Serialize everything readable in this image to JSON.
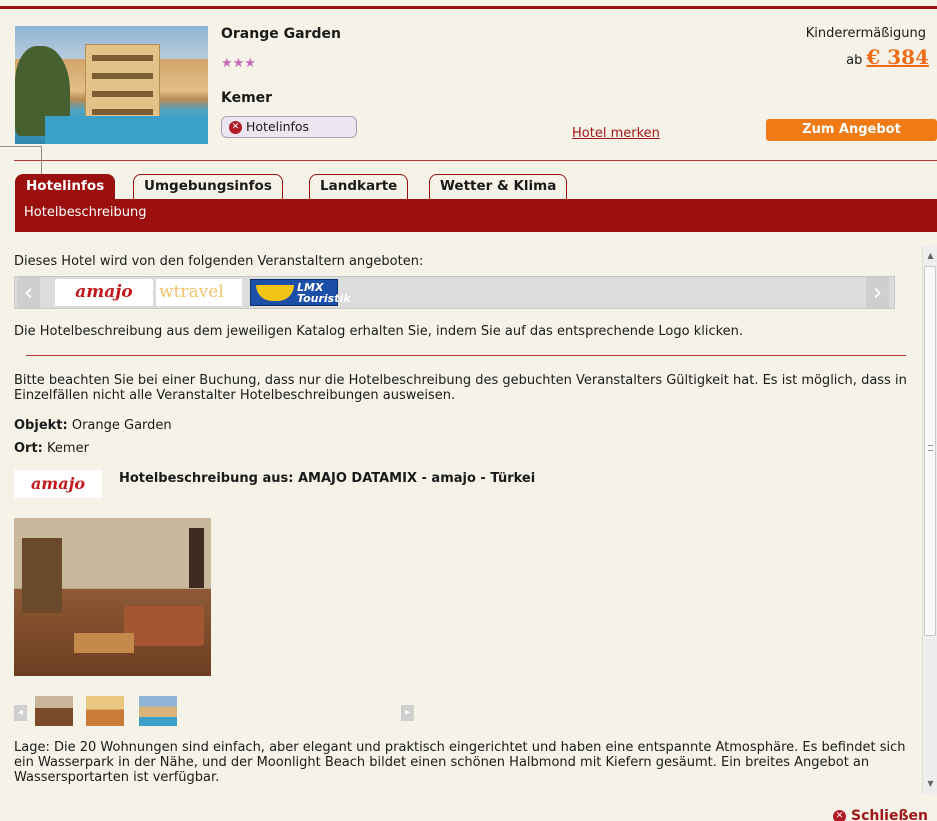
{
  "header": {
    "hotel_name": "Orange Garden",
    "stars": "★★★",
    "city": "Kemer",
    "hotelinfo_button": "Hotelinfos",
    "discount_label": "Kinderermäßigung",
    "price_prefix": "ab",
    "price": "€ 384",
    "merken_link": "Hotel merken",
    "offer_button": "Zum Angebot"
  },
  "tabs": [
    {
      "label": "Hotelinfos",
      "active": true
    },
    {
      "label": "Umgebungsinfos",
      "active": false
    },
    {
      "label": "Landkarte",
      "active": false
    },
    {
      "label": "Wetter & Klima",
      "active": false
    }
  ],
  "subtab": "Hotelbeschreibung",
  "content": {
    "intro": "Dieses Hotel wird von den folgenden Veranstaltern angeboten:",
    "operators": [
      "amajo",
      "wtravel",
      "LMX Touristik"
    ],
    "catalog_hint": "Die Hotelbeschreibung aus dem jeweiligen Katalog erhalten Sie, indem Sie auf das entsprechende Logo klicken.",
    "notice": "Bitte beachten Sie bei einer Buchung, dass nur die Hotelbeschreibung des gebuchten Veranstalters Gültigkeit hat. Es ist möglich, dass in Einzelfällen nicht alle Veranstalter Hotelbeschreibungen ausweisen.",
    "objekt_label": "Objekt:",
    "objekt_value": "Orange Garden",
    "ort_label": "Ort:",
    "ort_value": "Kemer",
    "desc_source": "Hotelbeschreibung aus: AMAJO DATAMIX - amajo - Türkei",
    "lage": "Lage: Die 20 Wohnungen sind einfach, aber elegant und praktisch eingerichtet und haben eine entspannte Atmosphäre. Es befindet sich ein Wasserpark in der Nähe, und der Moonlight Beach bildet einen schönen Halbmond mit Kiefern gesäumt. Ein breites Angebot an Wassersportarten ist verfügbar."
  },
  "footer": {
    "close": "Schließen"
  },
  "colors": {
    "brand": "#9b0f0f",
    "accent": "#ef7a16",
    "background": "#f5f3e8"
  }
}
